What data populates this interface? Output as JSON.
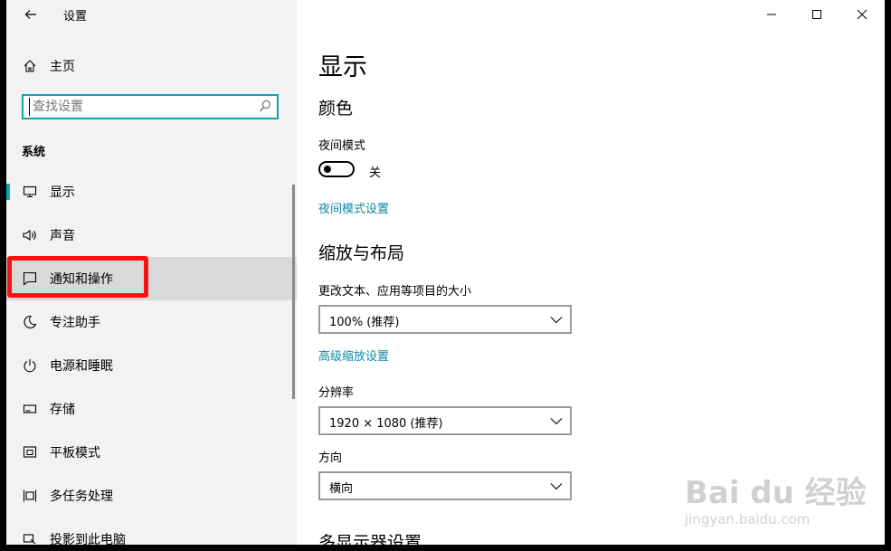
{
  "window": {
    "title": "设置",
    "controls": [
      "minimize",
      "maximize",
      "close"
    ]
  },
  "sidebar": {
    "home_label": "主页",
    "search_placeholder": "查找设置",
    "section": "系统",
    "items": [
      {
        "label": "显示",
        "icon": "monitor-icon",
        "selected": true
      },
      {
        "label": "声音",
        "icon": "speaker-icon"
      },
      {
        "label": "通知和操作",
        "icon": "notification-icon",
        "hover": true
      },
      {
        "label": "专注助手",
        "icon": "moon-icon"
      },
      {
        "label": "电源和睡眠",
        "icon": "power-icon"
      },
      {
        "label": "存储",
        "icon": "storage-icon"
      },
      {
        "label": "平板模式",
        "icon": "tablet-icon"
      },
      {
        "label": "多任务处理",
        "icon": "multitask-icon"
      },
      {
        "label": "投影到此电脑",
        "icon": "project-icon"
      }
    ]
  },
  "content": {
    "title": "显示",
    "color_heading": "颜色",
    "night_mode_label": "夜间模式",
    "night_mode_state": "关",
    "night_mode_link": "夜间模式设置",
    "scale_heading": "缩放与布局",
    "scale_label": "更改文本、应用等项目的大小",
    "scale_value": "100% (推荐)",
    "advanced_scale_link": "高级缩放设置",
    "resolution_label": "分辨率",
    "resolution_value": "1920 × 1080 (推荐)",
    "orientation_label": "方向",
    "orientation_value": "横向",
    "multi_display_heading": "多显示器设置"
  },
  "watermark": {
    "brand": "Bai du 经验",
    "url": "jingyan.baidu.com"
  },
  "colors": {
    "accent": "#10a3b5",
    "link": "#0f88a3",
    "highlight_box": "#ff1010"
  }
}
